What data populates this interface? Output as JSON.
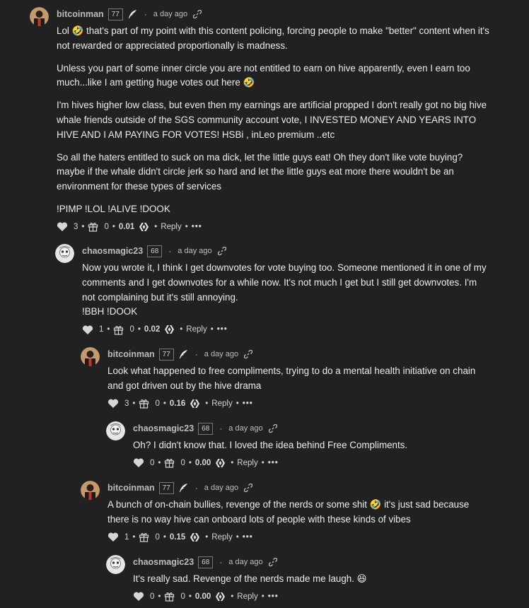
{
  "comments": [
    {
      "author": "bitcoinman",
      "rep": "77",
      "has_feather": true,
      "time": "a day ago",
      "paragraphs": [
        "Lol 🤣 that's part of my point with this content policing, forcing people to make \"better\" content when it's not rewarded or appreciated proportionally is madness.",
        "Unless you part of some inner circle you are not entitled to earn on hive apparently, even I earn too much...like I am getting huge votes out here 🤣",
        "I'm hives higher low class, but even then my earnings are artificial propped I don't really got no big hive whale friends outside of the SGS community account vote, I INVESTED MONEY AND YEARS INTO HIVE AND I AM PAYING FOR VOTES! HSBi , inLeo premium ..etc",
        "So all the haters entitled to suck on ma dick, let the little guys eat! Oh they don't like vote buying? maybe if the whale didn't circle jerk so hard and let the little guys eat more there wouldn't be an environment for these types of services",
        "!PIMP !LOL !ALIVE !DOOK"
      ],
      "votes": "3",
      "gifts": "0",
      "payout": "0.01",
      "reply_label": "Reply",
      "more_label": "•••"
    },
    {
      "author": "chaosmagic23",
      "rep": "68",
      "has_feather": false,
      "time": "a day ago",
      "paragraphs": [
        "Now you wrote it, I think I get downvotes for vote buying too. Someone mentioned it in one of my comments and I get downvotes for a while now. It's not much I get but I still get downvotes. I'm not complaining but it's still annoying.\n!BBH !DOOK"
      ],
      "votes": "1",
      "gifts": "0",
      "payout": "0.02",
      "reply_label": "Reply",
      "more_label": "•••"
    },
    {
      "author": "bitcoinman",
      "rep": "77",
      "has_feather": true,
      "time": "a day ago",
      "paragraphs": [
        "Look what happened to free compliments, trying to do a mental health initiative on chain and got driven out by the hive drama"
      ],
      "votes": "3",
      "gifts": "0",
      "payout": "0.16",
      "reply_label": "Reply",
      "more_label": "•••"
    },
    {
      "author": "chaosmagic23",
      "rep": "68",
      "has_feather": false,
      "time": "a day ago",
      "paragraphs": [
        "Oh? I didn't know that. I loved the idea behind Free Compliments."
      ],
      "votes": "0",
      "gifts": "0",
      "payout": "0.00",
      "reply_label": "Reply",
      "more_label": "•••"
    },
    {
      "author": "bitcoinman",
      "rep": "77",
      "has_feather": true,
      "time": "a day ago",
      "paragraphs": [
        "A bunch of on-chain bullies, revenge of the nerds or some shit 🤣 it's just sad because there is no way hive can onboard lots of people with these kinds of vibes"
      ],
      "votes": "1",
      "gifts": "0",
      "payout": "0.15",
      "reply_label": "Reply",
      "more_label": "•••"
    },
    {
      "author": "chaosmagic23",
      "rep": "68",
      "has_feather": false,
      "time": "a day ago",
      "paragraphs": [
        "It's really sad. Revenge of the nerds made me laugh. 😆"
      ],
      "votes": "0",
      "gifts": "0",
      "payout": "0.00",
      "reply_label": "Reply",
      "more_label": "•••"
    }
  ]
}
